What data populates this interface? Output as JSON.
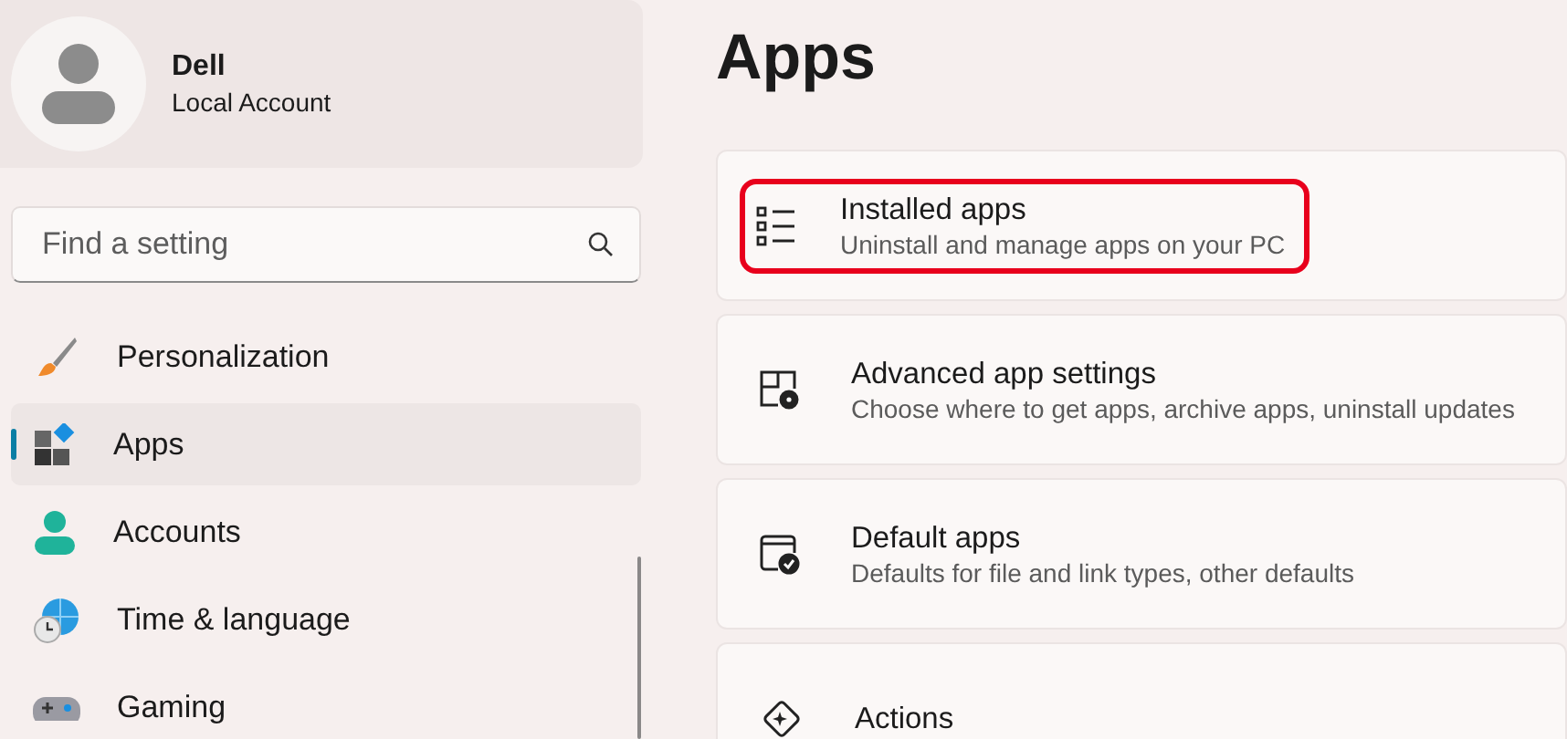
{
  "profile": {
    "name": "Dell",
    "account_type": "Local Account"
  },
  "search": {
    "placeholder": "Find a setting"
  },
  "nav": [
    {
      "label": "Personalization",
      "selected": false
    },
    {
      "label": "Apps",
      "selected": true
    },
    {
      "label": "Accounts",
      "selected": false
    },
    {
      "label": "Time & language",
      "selected": false
    },
    {
      "label": "Gaming",
      "selected": false
    }
  ],
  "page_title": "Apps",
  "cards": [
    {
      "title": "Installed apps",
      "description": "Uninstall and manage apps on your PC",
      "highlighted": true
    },
    {
      "title": "Advanced app settings",
      "description": "Choose where to get apps, archive apps, uninstall updates",
      "highlighted": false
    },
    {
      "title": "Default apps",
      "description": "Defaults for file and link types, other defaults",
      "highlighted": false
    },
    {
      "title": "Actions",
      "highlighted": false
    }
  ]
}
